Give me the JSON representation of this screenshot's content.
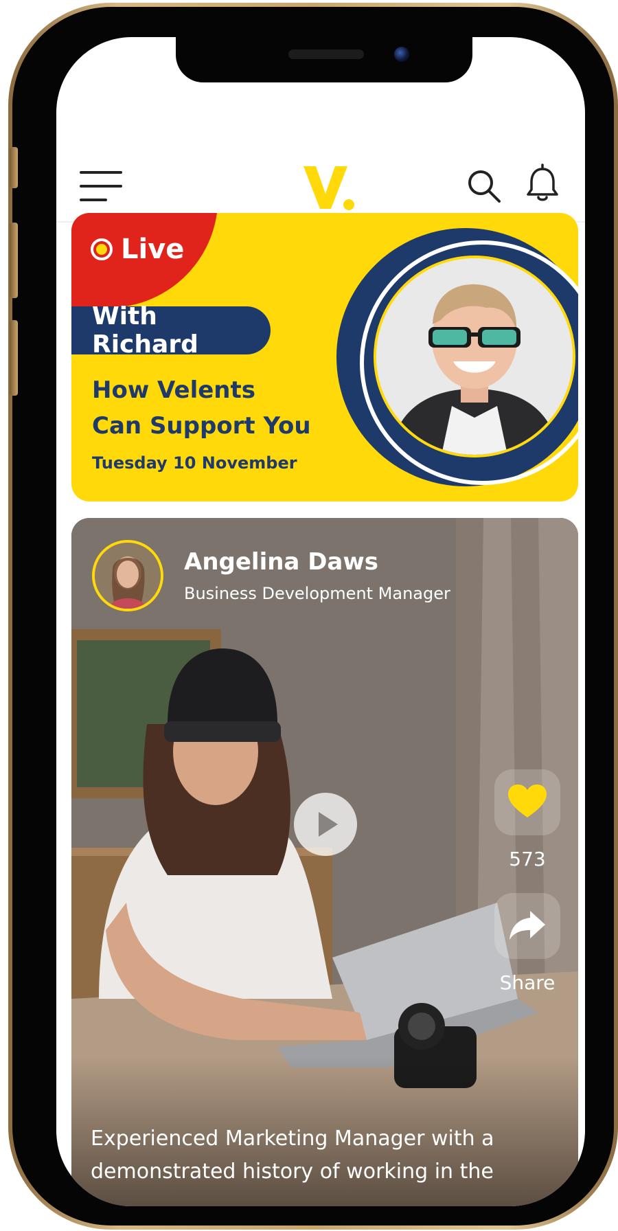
{
  "header": {
    "logo_letter": "V",
    "icons": [
      "menu-icon",
      "search-icon",
      "bell-icon"
    ]
  },
  "live": {
    "badge": "Live",
    "host": "With Richard",
    "title_line1": "How Velents",
    "title_line2": "Can Support You",
    "date": "Tuesday 10 November"
  },
  "post": {
    "author_name": "Angelina Daws",
    "author_role": "Business Development Manager",
    "likes": "573",
    "share_label": "Share",
    "description": "Experienced Marketing Manager with a demonstrated history of working in the"
  },
  "colors": {
    "accent_yellow": "#ffd90a",
    "navy": "#1e3a6b",
    "live_red": "#e0241c",
    "frame_gold": "#c9a56c"
  }
}
